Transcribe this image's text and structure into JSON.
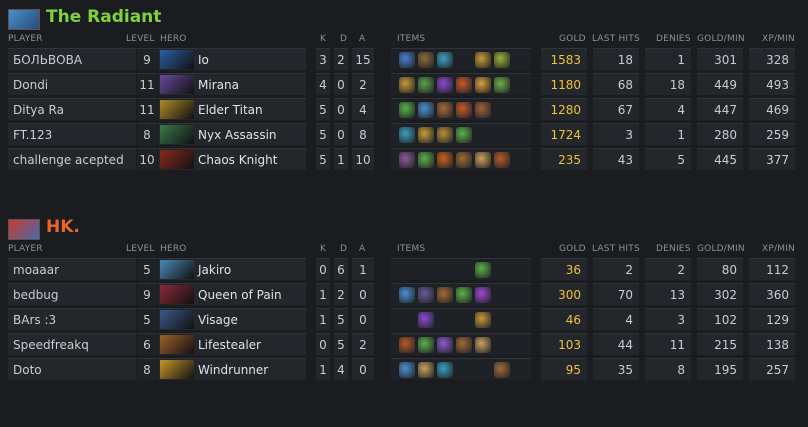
{
  "columns": {
    "player": "PLAYER",
    "level": "LEVEL",
    "hero": "HERO",
    "k": "K",
    "d": "D",
    "a": "A",
    "items": "ITEMS",
    "gold": "GOLD",
    "last_hits": "LAST HITS",
    "denies": "DENIES",
    "gpm": "GOLD/MIN",
    "xpm": "XP/MIN"
  },
  "teams": [
    {
      "name": "The Radiant",
      "color": "#7ed23a",
      "players": [
        {
          "player": "БОЛЬВОВА",
          "level": "9",
          "hero": "Io",
          "k": "3",
          "d": "2",
          "a": "15",
          "gold": "1583",
          "last_hits": "18",
          "denies": "1",
          "gpm": "301",
          "xpm": "328",
          "hero_color": "#2a5fa8",
          "items": [
            "#4a7fd0",
            "#8a6a3a",
            "#3aa0c0",
            "",
            "#c89a3a",
            "#9ab03a"
          ]
        },
        {
          "player": "Dondi",
          "level": "11",
          "hero": "Mirana",
          "k": "4",
          "d": "0",
          "a": "2",
          "gold": "1180",
          "last_hits": "68",
          "denies": "18",
          "gpm": "449",
          "xpm": "493",
          "hero_color": "#6a4a9a",
          "items": [
            "#c89a3a",
            "#5aa04a",
            "#8a4ad0",
            "#c85a2a",
            "#d8a040",
            "#6ab04a"
          ]
        },
        {
          "player": "Ditya Ra",
          "level": "11",
          "hero": "Elder Titan",
          "k": "5",
          "d": "0",
          "a": "4",
          "gold": "1280",
          "last_hits": "67",
          "denies": "4",
          "gpm": "447",
          "xpm": "469",
          "hero_color": "#b08a2a",
          "items": [
            "#5ab04a",
            "#4a90d0",
            "#a06a3a",
            "#c85a2a",
            "#a0603a",
            ""
          ]
        },
        {
          "player": "FT.123",
          "level": "8",
          "hero": "Nyx Assassin",
          "k": "5",
          "d": "0",
          "a": "8",
          "gold": "1724",
          "last_hits": "3",
          "denies": "1",
          "gpm": "280",
          "xpm": "259",
          "hero_color": "#3a7a4a",
          "items": [
            "#3aa0c0",
            "#c89a3a",
            "#b8903a",
            "#5ab04a",
            "",
            ""
          ]
        },
        {
          "player": "challenge acepted",
          "level": "10",
          "hero": "Chaos Knight",
          "k": "5",
          "d": "1",
          "a": "10",
          "gold": "235",
          "last_hits": "43",
          "denies": "5",
          "gpm": "445",
          "xpm": "377",
          "hero_color": "#8a2a1a",
          "items": [
            "#8a5a9a",
            "#5ab04a",
            "#c8601a",
            "#a06a3a",
            "#c8a060",
            "#b85a2a"
          ]
        }
      ]
    },
    {
      "name": "HK.",
      "color": "#e8652a",
      "players": [
        {
          "player": "moaaar",
          "level": "5",
          "hero": "Jakiro",
          "k": "0",
          "d": "6",
          "a": "1",
          "gold": "36",
          "last_hits": "2",
          "denies": "2",
          "gpm": "80",
          "xpm": "112",
          "hero_color": "#4a8ab8",
          "items": [
            "",
            "",
            "",
            "",
            "#5ab04a",
            ""
          ]
        },
        {
          "player": "bedbug",
          "level": "9",
          "hero": "Queen of Pain",
          "k": "1",
          "d": "2",
          "a": "0",
          "gold": "300",
          "last_hits": "70",
          "denies": "13",
          "gpm": "302",
          "xpm": "360",
          "hero_color": "#8a2a3a",
          "items": [
            "#4a90d0",
            "#6a5a9a",
            "#a06a3a",
            "#5ab04a",
            "#9a4ad0",
            ""
          ]
        },
        {
          "player": "BArs :3",
          "level": "5",
          "hero": "Visage",
          "k": "1",
          "d": "5",
          "a": "0",
          "gold": "46",
          "last_hits": "4",
          "denies": "3",
          "gpm": "102",
          "xpm": "129",
          "hero_color": "#3a5a8a",
          "items": [
            "",
            "#8a4ad0",
            "",
            "",
            "#c89a3a",
            ""
          ]
        },
        {
          "player": "Speedfreakq",
          "level": "6",
          "hero": "Lifestealer",
          "k": "0",
          "d": "5",
          "a": "2",
          "gold": "103",
          "last_hits": "44",
          "denies": "11",
          "gpm": "215",
          "xpm": "138",
          "hero_color": "#a0602a",
          "items": [
            "#b85a2a",
            "#5ab04a",
            "#8a5ad0",
            "#a06a3a",
            "#c8a060",
            ""
          ]
        },
        {
          "player": "Doto",
          "level": "8",
          "hero": "Windrunner",
          "k": "1",
          "d": "4",
          "a": "0",
          "gold": "95",
          "last_hits": "35",
          "denies": "8",
          "gpm": "195",
          "xpm": "257",
          "hero_color": "#c8962a",
          "items": [
            "#4a90d0",
            "#c8a060",
            "#3aa0c0",
            "",
            "",
            "#a06a3a"
          ]
        }
      ]
    }
  ]
}
